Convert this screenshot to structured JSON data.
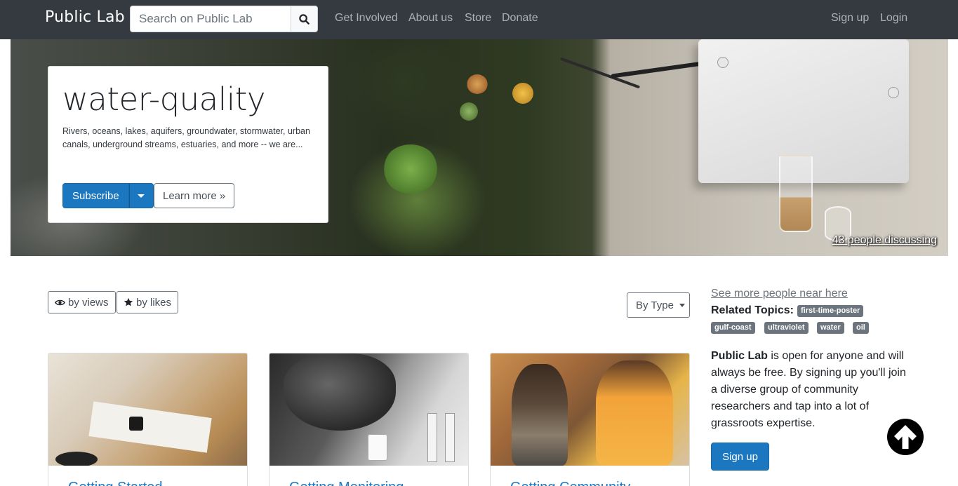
{
  "navbar": {
    "brand": "Public Lab",
    "search_placeholder": "Search on Public Lab",
    "links": [
      "Get Involved",
      "About us",
      "Store",
      "Donate"
    ],
    "right_links": [
      "Sign up",
      "Login"
    ]
  },
  "hero": {
    "title": "water-quality",
    "description": "Rivers, oceans, lakes, aquifers, groundwater, stormwater, urban canals, underground streams, estuaries, and more -- we are...",
    "subscribe_label": "Subscribe",
    "learn_more_label": "Learn more »",
    "discussing": "43 people discussing"
  },
  "sort": {
    "by_views": "by views",
    "by_likes": "by likes",
    "by_type": "By Type"
  },
  "cards": [
    {
      "title": "Getting Started..."
    },
    {
      "title": "Getting Monitoring..."
    },
    {
      "title": "Getting Community..."
    }
  ],
  "sidebar": {
    "near_here": "See more people near here",
    "related_label": "Related Topics:",
    "tags": [
      "first-time-poster",
      "gulf-coast",
      "ultraviolet",
      "water",
      "oil"
    ],
    "about_bold": "Public Lab",
    "about_rest": " is open for anyone and will always be free. By signing up you'll join a diverse group of community researchers and tap into a lot of grassroots expertise.",
    "signup_label": "Sign up"
  },
  "icons": {
    "search": "search-icon",
    "eye": "eye-icon",
    "star": "star-icon",
    "back_to_top": "arrow-up-circle-icon"
  },
  "colors": {
    "navbar": "#343a40",
    "primary": "#1b78c0",
    "tag": "#6c757d"
  }
}
